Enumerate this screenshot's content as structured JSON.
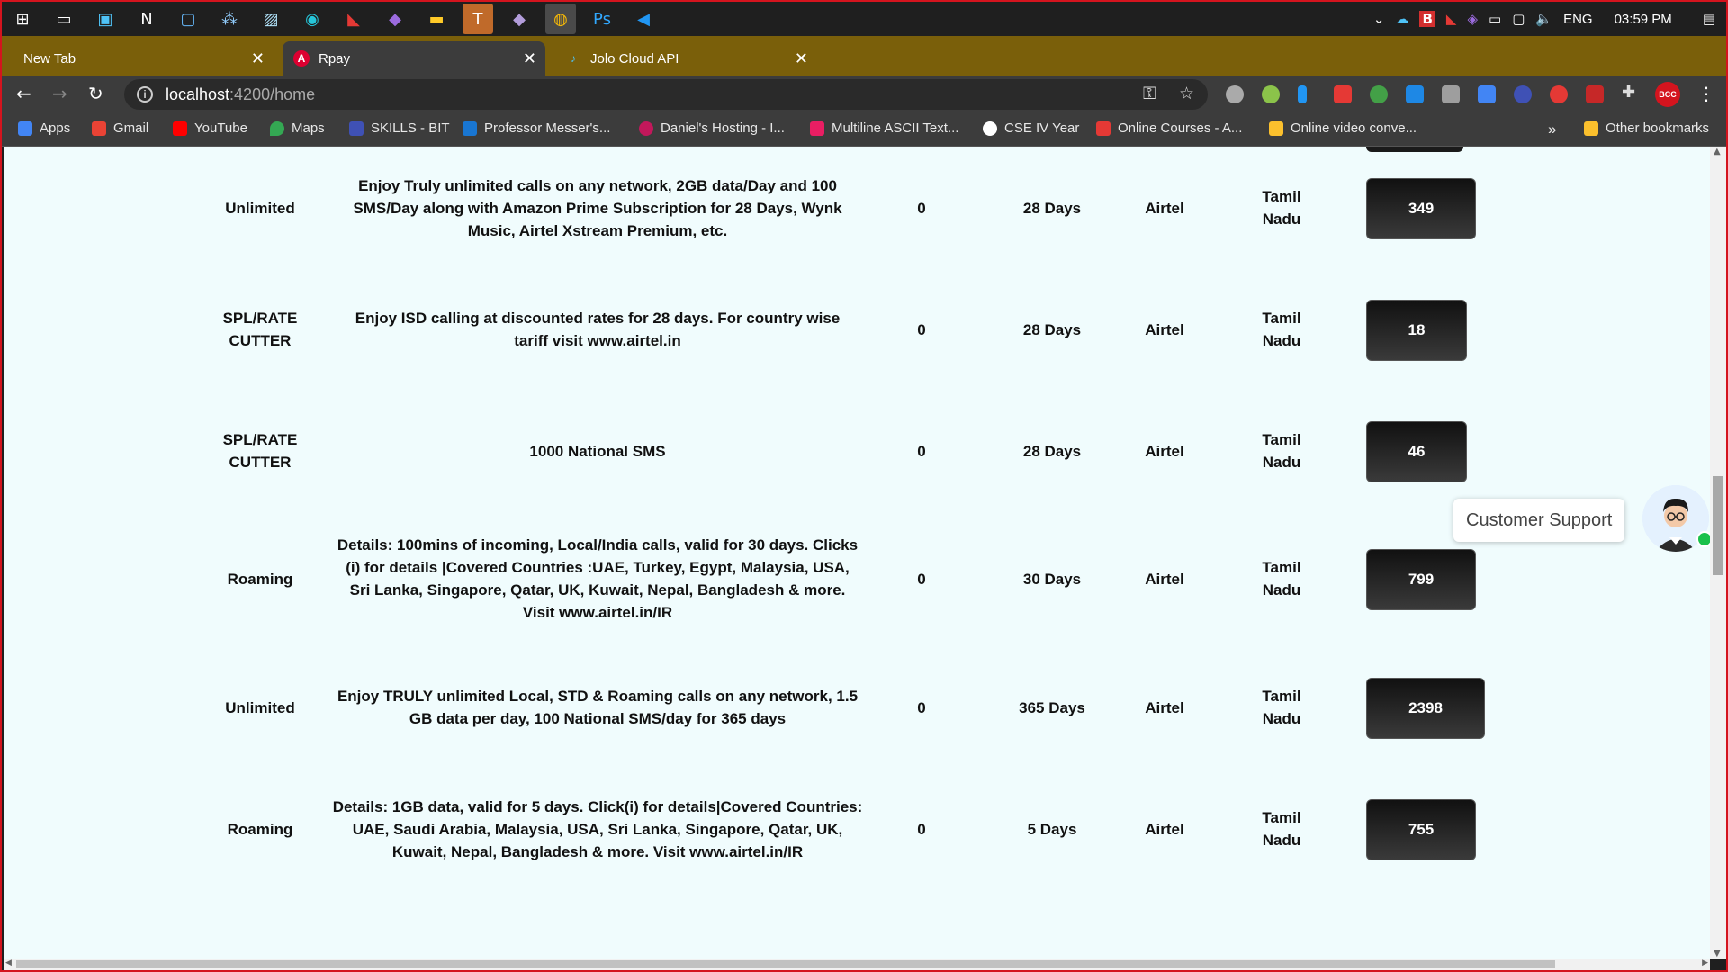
{
  "taskbar": {
    "icons": [
      "windows-start-icon",
      "task-view-icon",
      "taskbar-app-icon",
      "notion-icon",
      "taskbar-app-icon",
      "blackberry-icon",
      "photos-icon",
      "edge-icon",
      "taskbar-app-icon",
      "visual-studio-icon",
      "file-explorer-icon",
      "teams-icon",
      "visual-studio-icon",
      "chrome-icon",
      "photoshop-icon",
      "vscode-icon"
    ],
    "language": "ENG",
    "time": "03:59 PM"
  },
  "tabs": [
    {
      "title": "New Tab"
    },
    {
      "title": "Rpay"
    },
    {
      "title": "Jolo Cloud API"
    }
  ],
  "address_bar": {
    "host": "localhost",
    "path": ":4200/home"
  },
  "bookmarks": {
    "items": [
      {
        "label": "Apps",
        "color": "#4285f4"
      },
      {
        "label": "Gmail",
        "color": "#ea4335"
      },
      {
        "label": "YouTube",
        "color": "#ff0000"
      },
      {
        "label": "Maps",
        "color": "#34a853"
      },
      {
        "label": "SKILLS - BIT",
        "color": "#3f51b5"
      },
      {
        "label": "Professor Messer's...",
        "color": "#1976d2"
      },
      {
        "label": "Daniel's Hosting - I...",
        "color": "#c2185b"
      },
      {
        "label": "Multiline ASCII Text...",
        "color": "#e91e63"
      },
      {
        "label": "CSE IV Year",
        "color": "#ffffff"
      },
      {
        "label": "Online Courses - A...",
        "color": "#e53935"
      },
      {
        "label": "Online video conve...",
        "color": "#fbc02d"
      }
    ],
    "overflow": "»",
    "other": "Other bookmarks"
  },
  "plans": [
    {
      "type": "Unlimited",
      "description": "Enjoy Truly unlimited calls on any network, 2GB data/Day and 100 SMS/Day along with Amazon Prime Subscription for 28 Days, Wynk Music, Airtel Xstream Premium, etc.",
      "talktime": "0",
      "validity": "28 Days",
      "operator": "Airtel",
      "circle": "Tamil Nadu",
      "price": "349"
    },
    {
      "type": "SPL/RATE CUTTER",
      "description": "Enjoy ISD calling at discounted rates for 28 days. For country wise tariff visit www.airtel.in",
      "talktime": "0",
      "validity": "28 Days",
      "operator": "Airtel",
      "circle": "Tamil Nadu",
      "price": "18"
    },
    {
      "type": "SPL/RATE CUTTER",
      "description": "1000 National SMS",
      "talktime": "0",
      "validity": "28 Days",
      "operator": "Airtel",
      "circle": "Tamil Nadu",
      "price": "46"
    },
    {
      "type": "Roaming",
      "description": "Details: 100mins of incoming, Local/India calls, valid for 30 days. Clicks (i) for details |Covered Countries :UAE, Turkey, Egypt, Malaysia, USA, Sri Lanka, Singapore, Qatar, UK, Kuwait, Nepal, Bangladesh & more. Visit www.airtel.in/IR",
      "talktime": "0",
      "validity": "30 Days",
      "operator": "Airtel",
      "circle": "Tamil Nadu",
      "price": "799"
    },
    {
      "type": "Unlimited",
      "description": "Enjoy TRULY unlimited Local, STD & Roaming calls on any network, 1.5 GB data per day, 100 National SMS/day for 365 days",
      "talktime": "0",
      "validity": "365 Days",
      "operator": "Airtel",
      "circle": "Tamil Nadu",
      "price": "2398"
    },
    {
      "type": "Roaming",
      "description": "Details: 1GB data, valid for 5 days. Click(i) for details|Covered Countries: UAE, Saudi Arabia, Malaysia, USA, Sri Lanka, Singapore, Qatar, UK, Kuwait, Nepal, Bangladesh & more. Visit www.airtel.in/IR",
      "talktime": "0",
      "validity": "5 Days",
      "operator": "Airtel",
      "circle": "Tamil Nadu",
      "price": "755"
    }
  ],
  "support": {
    "label": "Customer Support",
    "status_color": "#19c14b"
  }
}
